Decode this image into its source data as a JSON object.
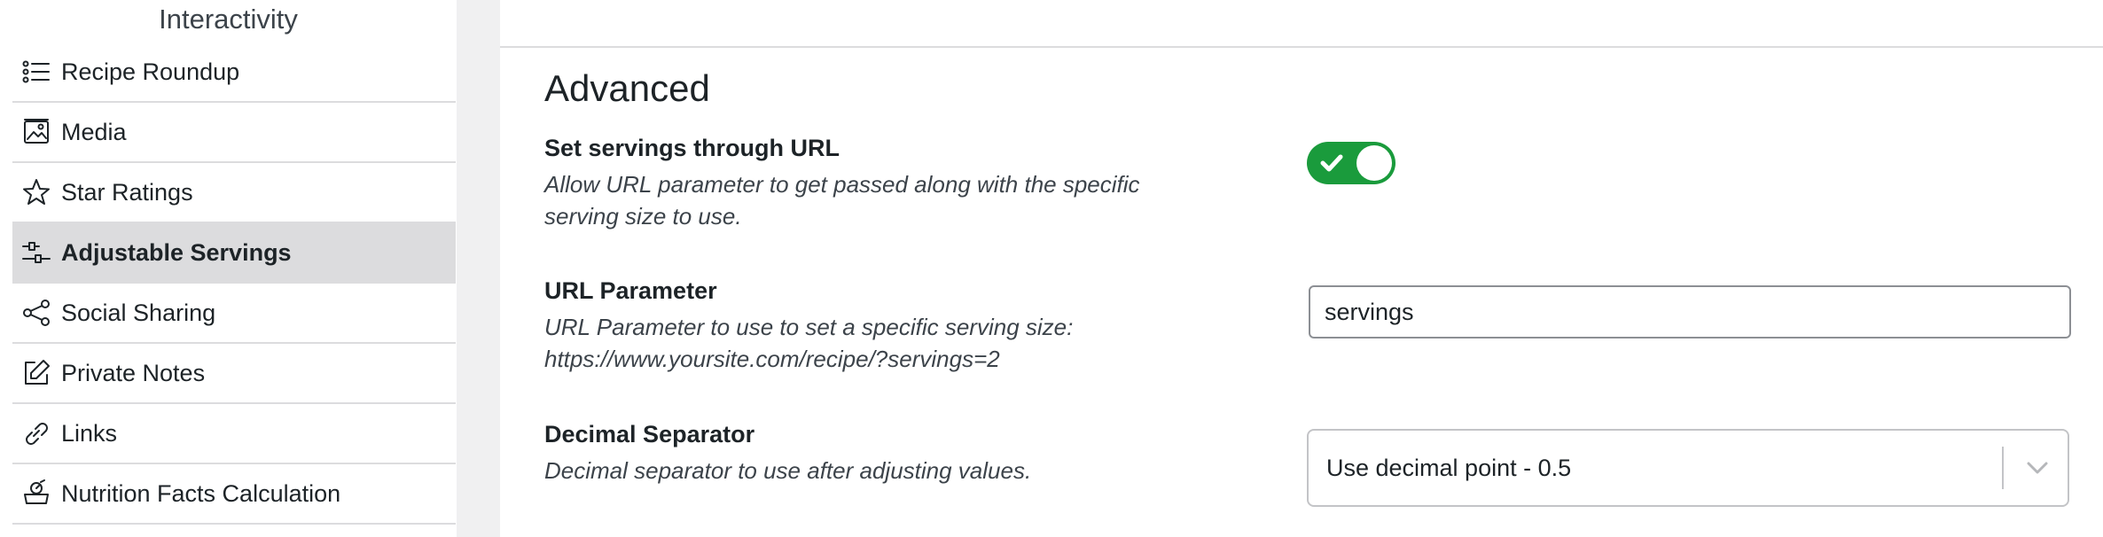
{
  "sidebar": {
    "heading": "Interactivity",
    "items": [
      {
        "label": "Recipe Roundup",
        "icon": "list-icon",
        "active": false
      },
      {
        "label": "Media",
        "icon": "image-icon",
        "active": false
      },
      {
        "label": "Star Ratings",
        "icon": "star-icon",
        "active": false
      },
      {
        "label": "Adjustable Servings",
        "icon": "sliders-icon",
        "active": true
      },
      {
        "label": "Social Sharing",
        "icon": "share-icon",
        "active": false
      },
      {
        "label": "Private Notes",
        "icon": "edit-icon",
        "active": false
      },
      {
        "label": "Links",
        "icon": "link-icon",
        "active": false
      },
      {
        "label": "Nutrition Facts Calculation",
        "icon": "scale-icon",
        "active": false
      }
    ]
  },
  "main": {
    "section_title": "Advanced",
    "settings": [
      {
        "label": "Set servings through URL",
        "description_line1": "Allow URL parameter to get passed along with the specific",
        "description_line2": "serving size to use.",
        "control": "toggle",
        "enabled": true
      },
      {
        "label": "URL Parameter",
        "description_line1": "URL Parameter to use to set a specific serving size:",
        "description_line2": "https://www.yoursite.com/recipe/?servings=2",
        "control": "text",
        "value": "servings"
      },
      {
        "label": "Decimal Separator",
        "description_line1": "Decimal separator to use after adjusting values.",
        "control": "select",
        "value": "Use decimal point - 0.5"
      }
    ]
  },
  "colors": {
    "toggle_on": "#1a9b3c",
    "active_item_bg": "#dcdcde"
  }
}
